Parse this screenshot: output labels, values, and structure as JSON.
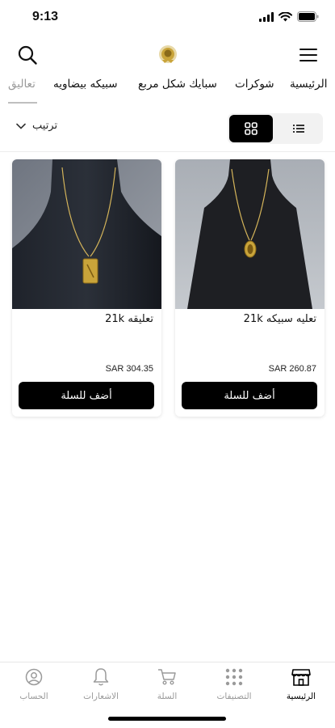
{
  "status_bar": {
    "time": "9:13"
  },
  "header": {
    "search_icon": "search-icon",
    "logo_icon": "gold-medal-logo",
    "menu_icon": "hamburger-menu-icon"
  },
  "categories": [
    {
      "label": "الرئيسية",
      "active": false
    },
    {
      "label": "شوكرات",
      "active": false
    },
    {
      "label": "سبايك شكل مربع",
      "active": false
    },
    {
      "label": "سبيكه بيضاويه",
      "active": false
    },
    {
      "label": "تعاليق",
      "active": true
    }
  ],
  "toolbar": {
    "sort_label": "ترتيب",
    "view_mode": "grid"
  },
  "products": [
    {
      "name": "تعليقه 21k",
      "price": "SAR 304.35",
      "button": "أضف للسلة"
    },
    {
      "name": "تعليه سبيكه 21k",
      "price": "SAR 260.87",
      "button": "أضف للسلة"
    }
  ],
  "bottom_nav": [
    {
      "label": "الحساب",
      "icon": "account-icon",
      "active": false
    },
    {
      "label": "الاشعارات",
      "icon": "bell-icon",
      "active": false
    },
    {
      "label": "السلة",
      "icon": "cart-icon",
      "active": false
    },
    {
      "label": "التصنيفات",
      "icon": "categories-grid-icon",
      "active": false
    },
    {
      "label": "الرئيسية",
      "icon": "store-icon",
      "active": true
    }
  ],
  "colors": {
    "accent": "#000000",
    "inactive": "#9a9a9a",
    "logo_gold": "#c9a43a"
  }
}
